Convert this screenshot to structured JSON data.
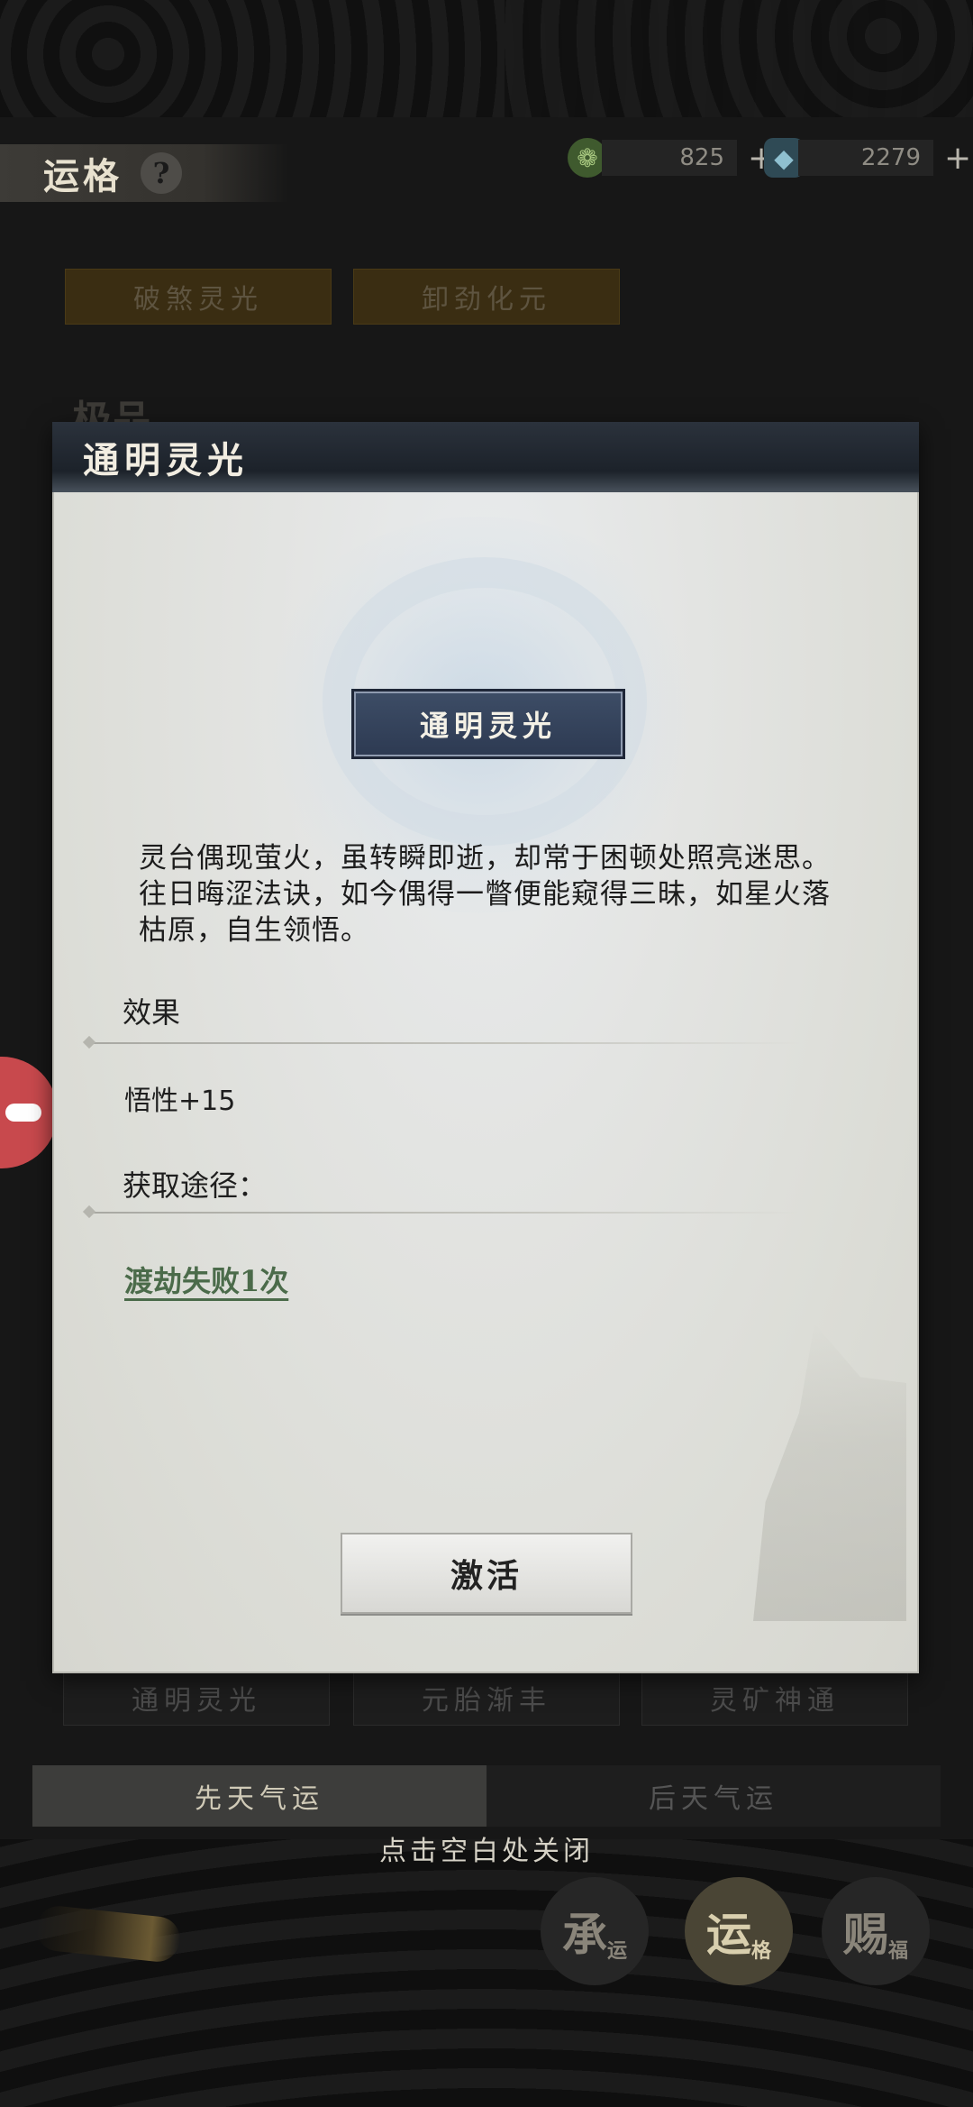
{
  "header": {
    "title": "运格",
    "help_icon": "?",
    "currencies": [
      {
        "icon": "jade-coin-icon",
        "value": "825",
        "plus": "+"
      },
      {
        "icon": "spirit-stone-icon",
        "value": "2279",
        "plus": "+"
      }
    ]
  },
  "background": {
    "top_tabs": [
      "破煞灵光",
      "卸劲化元"
    ],
    "grade_label": "极品",
    "lower_tabs": [
      "通明灵光",
      "元胎渐丰",
      "灵矿神通"
    ],
    "bottom_tabs": [
      "先天气运",
      "后天气运"
    ],
    "close_hint": "点击空白处关闭",
    "nav_buttons": [
      {
        "main": "承",
        "sub": "运"
      },
      {
        "main": "运",
        "sub": "格"
      },
      {
        "main": "赐",
        "sub": "福"
      }
    ]
  },
  "modal": {
    "title": "通明灵光",
    "badge": "通明灵光",
    "description": "灵台偶现萤火，虽转瞬即逝，却常于困顿处照亮迷思。往日晦涩法诀，如今偶得一瞥便能窥得三昧，如星火落枯原，自生领悟。",
    "effect_label": "效果",
    "effect_value": "悟性+15",
    "source_label": "获取途径：",
    "source_link": "渡劫失败1次",
    "activate_button": "激活"
  },
  "colors": {
    "modal_bg": "#e3e4e2",
    "header_bg": "#1c222a",
    "badge_bg": "#2d3a52",
    "link_green": "#4b6b4a",
    "float_red": "#c8494d"
  }
}
